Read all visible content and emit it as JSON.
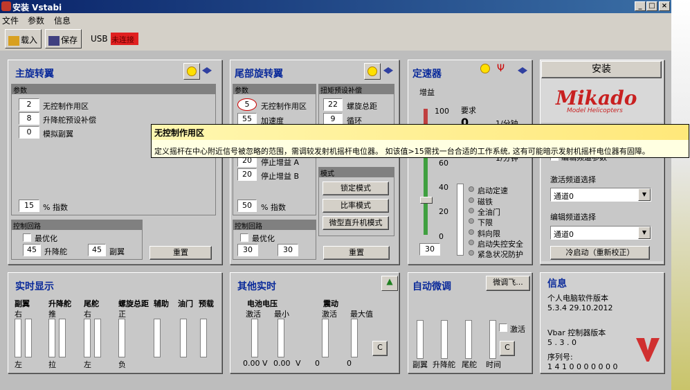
{
  "window": {
    "title": "安装 Vstabi"
  },
  "menu": [
    "文件",
    "参数",
    "信息"
  ],
  "toolbar": {
    "load": "载入",
    "save": "保存",
    "usb": "USB",
    "status": "未连接",
    "status_color": "#e02020"
  },
  "main_rotor": {
    "title": "主旋转翼",
    "params_header": "参数",
    "rows": [
      {
        "value": "2",
        "label": "无控制作用区"
      },
      {
        "value": "8",
        "label": "升降舵预设补偿"
      },
      {
        "value": "0",
        "label": "模拟副翼"
      }
    ],
    "index_value": "15",
    "index_label": "% 指数",
    "control_header": "控制回路",
    "optimize": "最优化",
    "elev_value": "45",
    "elev_label": "升降舵",
    "ail_value": "45",
    "ail_label": "副翼",
    "reset": "重置"
  },
  "tail_rotor": {
    "title": "尾部旋转翼",
    "params_header": "参数",
    "rows": [
      {
        "value": "5",
        "label": "无控制作用区"
      },
      {
        "value": "55",
        "label": "加速度"
      },
      {
        "value": "20",
        "label": "停止增益 A"
      },
      {
        "value": "20",
        "label": "停止增益 B"
      }
    ],
    "index_value": "50",
    "index_label": "% 指数",
    "torque_header": "扭矩预设补偿",
    "torque_rows": [
      {
        "value": "22",
        "label": "螺旋总距"
      },
      {
        "value": "9",
        "label": "循环"
      }
    ],
    "mode_header": "模式",
    "modes": [
      "锁定模式",
      "比率模式",
      "微型直升机模式"
    ],
    "control_header": "控制回路",
    "optimize": "最优化",
    "v1": "30",
    "v2": "30",
    "reset": "重置"
  },
  "gyro": {
    "title": "定速器",
    "gain_label": "增益",
    "scale": [
      "100",
      "80",
      "60",
      "40",
      "20",
      "0"
    ],
    "gain_value": "30",
    "req_label": "要求",
    "req_value": "0",
    "rpm_unit": "1/分钟",
    "rpm_unit2": "1/分钟",
    "status": [
      "启动定速",
      "磁铁",
      "全油门",
      "下限",
      "斜向限",
      "启动失控安全",
      "紧急状况防护"
    ]
  },
  "install": {
    "button": "安装",
    "logo": "Mikado",
    "logo_sub": "Model Helicopters",
    "partial_label": "编辑频道参数",
    "active_label": "激活频道选择",
    "active_value": "通道0",
    "edit_label": "编辑频道选择",
    "edit_value": "通道0",
    "cold_start": "冷启动（重新校正）"
  },
  "realtime": {
    "title": "实时显示",
    "cols": [
      {
        "label": "副翼",
        "top": "右",
        "bottom": "左"
      },
      {
        "label": "升降舵",
        "top": "推",
        "bottom": "拉"
      },
      {
        "label": "尾舵",
        "top": "右",
        "bottom": "左"
      },
      {
        "label": "螺旋总距",
        "top": "正",
        "bottom": "负"
      },
      {
        "label": "辅助",
        "top": "",
        "bottom": ""
      },
      {
        "label": "油门",
        "top": "",
        "bottom": ""
      },
      {
        "label": "预载",
        "top": "",
        "bottom": ""
      }
    ]
  },
  "other": {
    "title": "其他实时",
    "battery": "电池电压",
    "active": "激活",
    "min": "最小",
    "v1": "0.00",
    "v2": "0.00",
    "unit": "V",
    "vibration": "震动",
    "active2": "激活",
    "max": "最大值",
    "vib1": "0",
    "vib2": "0",
    "clear": "C"
  },
  "autotune": {
    "title": "自动微调",
    "button": "微调飞...",
    "cols": [
      "副翼",
      "升降舵",
      "尾舵",
      "时间"
    ],
    "activate": "激活",
    "clear": "C"
  },
  "info": {
    "title": "信息",
    "pc_label": "个人电脑软件版本",
    "pc_version": "5.3.4  29.10.2012",
    "vbar_label": "Vbar 控制器版本",
    "vbar_version": "5 . 3 . 0",
    "serial_label": "序列号:",
    "serial": "1 4 1 0 0 0 0 0 0 0"
  },
  "tooltip": {
    "title": "无控制作用区",
    "text": "定义摇杆在中心附近信号被忽略的范围，需调较发射机摇杆电位器。 如该值>15需找一台合适的工作系统, 这有可能暗示发射机摇杆电位器有固障。"
  }
}
